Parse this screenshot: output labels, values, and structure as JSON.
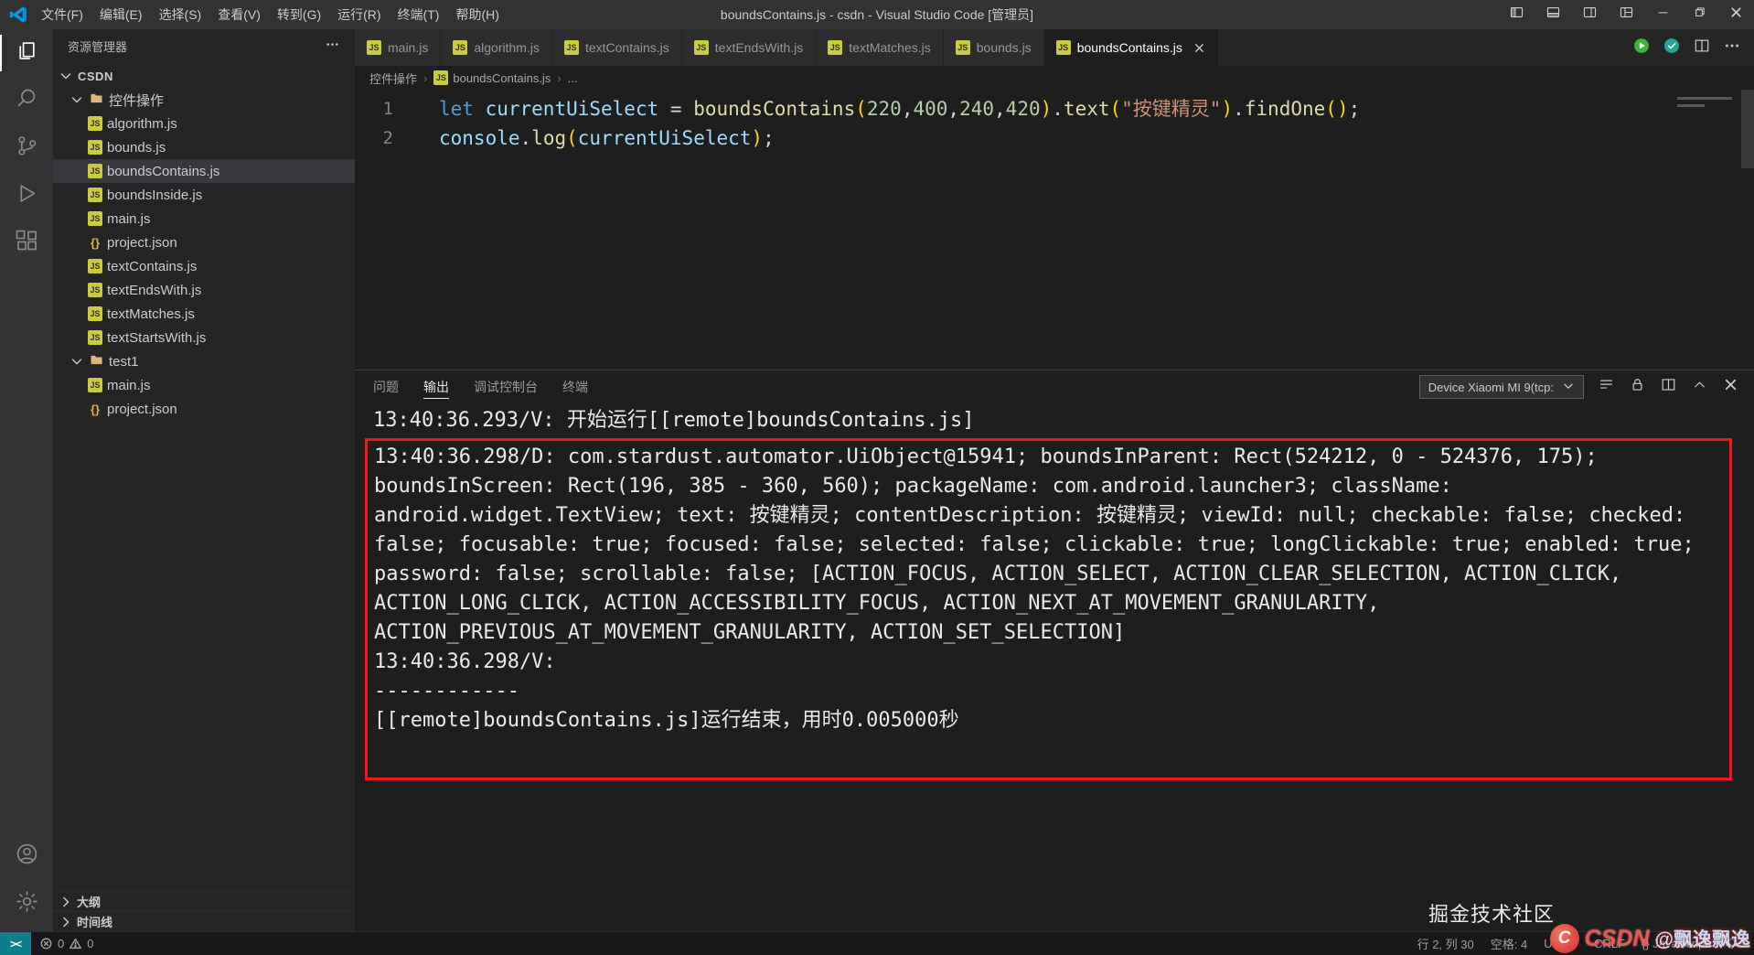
{
  "window": {
    "title": "boundsContains.js - csdn - Visual Studio Code [管理员]"
  },
  "menu_bar": [
    {
      "key": "file",
      "label": "文件(F)"
    },
    {
      "key": "edit",
      "label": "编辑(E)"
    },
    {
      "key": "selection",
      "label": "选择(S)"
    },
    {
      "key": "view",
      "label": "查看(V)"
    },
    {
      "key": "go",
      "label": "转到(G)"
    },
    {
      "key": "run",
      "label": "运行(R)"
    },
    {
      "key": "terminal",
      "label": "终端(T)"
    },
    {
      "key": "help",
      "label": "帮助(H)"
    }
  ],
  "activity_bar": {
    "top": [
      {
        "name": "explorer",
        "icon": "files-icon",
        "active": true
      },
      {
        "name": "search",
        "icon": "search-icon"
      },
      {
        "name": "source-control",
        "icon": "source-control-icon"
      },
      {
        "name": "run-debug",
        "icon": "run-debug-icon"
      },
      {
        "name": "extensions",
        "icon": "extensions-icon"
      }
    ],
    "bottom": [
      {
        "name": "account",
        "icon": "account-icon"
      },
      {
        "name": "settings",
        "icon": "settings-gear-icon"
      }
    ]
  },
  "explorer": {
    "header": "资源管理器",
    "tree": [
      {
        "label": "CSDN",
        "type": "root",
        "indent": 0,
        "expanded": true
      },
      {
        "label": "控件操作",
        "type": "folder",
        "indent": 1,
        "expanded": true
      },
      {
        "label": "algorithm.js",
        "type": "js",
        "indent": 2
      },
      {
        "label": "bounds.js",
        "type": "js",
        "indent": 2
      },
      {
        "label": "boundsContains.js",
        "type": "js",
        "indent": 2,
        "selected": true
      },
      {
        "label": "boundsInside.js",
        "type": "js",
        "indent": 2
      },
      {
        "label": "main.js",
        "type": "js",
        "indent": 2
      },
      {
        "label": "project.json",
        "type": "json",
        "indent": 2
      },
      {
        "label": "textContains.js",
        "type": "js",
        "indent": 2
      },
      {
        "label": "textEndsWith.js",
        "type": "js",
        "indent": 2
      },
      {
        "label": "textMatches.js",
        "type": "js",
        "indent": 2
      },
      {
        "label": "textStartsWith.js",
        "type": "js",
        "indent": 2
      },
      {
        "label": "test1",
        "type": "folder",
        "indent": 1,
        "expanded": true
      },
      {
        "label": "main.js",
        "type": "js",
        "indent": 2
      },
      {
        "label": "project.json",
        "type": "json",
        "indent": 2
      }
    ],
    "bottom_sections": [
      {
        "label": "大纲"
      },
      {
        "label": "时间线"
      }
    ]
  },
  "editor_tabs": [
    {
      "label": "main.js"
    },
    {
      "label": "algorithm.js"
    },
    {
      "label": "textContains.js"
    },
    {
      "label": "textEndsWith.js"
    },
    {
      "label": "textMatches.js"
    },
    {
      "label": "bounds.js"
    },
    {
      "label": "boundsContains.js",
      "active": true
    }
  ],
  "tab_actions": [
    {
      "name": "run",
      "icon": "run-icon"
    },
    {
      "name": "device-connect",
      "icon": "device-connect-icon"
    },
    {
      "name": "split-editor",
      "icon": "split-editor-icon"
    },
    {
      "name": "more-actions",
      "icon": "more-actions-icon"
    }
  ],
  "breadcrumb": [
    {
      "label": "控件操作"
    },
    {
      "label": "boundsContains.js",
      "icon": "js"
    },
    {
      "label": "..."
    }
  ],
  "editor": {
    "lines": [
      {
        "number": "1",
        "tokens": [
          {
            "t": "let",
            "c": "kw"
          },
          {
            "t": " ",
            "c": "pun"
          },
          {
            "t": "currentUiSelect",
            "c": "var"
          },
          {
            "t": " ",
            "c": "pun"
          },
          {
            "t": "=",
            "c": "pun"
          },
          {
            "t": " ",
            "c": "pun"
          },
          {
            "t": "boundsContains",
            "c": "fn"
          },
          {
            "t": "(",
            "c": "br"
          },
          {
            "t": "220",
            "c": "num"
          },
          {
            "t": ",",
            "c": "pun"
          },
          {
            "t": "400",
            "c": "num"
          },
          {
            "t": ",",
            "c": "pun"
          },
          {
            "t": "240",
            "c": "num"
          },
          {
            "t": ",",
            "c": "pun"
          },
          {
            "t": "420",
            "c": "num"
          },
          {
            "t": ")",
            "c": "br"
          },
          {
            "t": ".",
            "c": "pun"
          },
          {
            "t": "text",
            "c": "fn"
          },
          {
            "t": "(",
            "c": "br"
          },
          {
            "t": "\"按键精灵\"",
            "c": "str"
          },
          {
            "t": ")",
            "c": "br"
          },
          {
            "t": ".",
            "c": "pun"
          },
          {
            "t": "findOne",
            "c": "fn"
          },
          {
            "t": "(",
            "c": "br"
          },
          {
            "t": ")",
            "c": "br"
          },
          {
            "t": ";",
            "c": "pun"
          }
        ]
      },
      {
        "number": "2",
        "tokens": [
          {
            "t": "console",
            "c": "var"
          },
          {
            "t": ".",
            "c": "pun"
          },
          {
            "t": "log",
            "c": "fn"
          },
          {
            "t": "(",
            "c": "br"
          },
          {
            "t": "currentUiSelect",
            "c": "var"
          },
          {
            "t": ")",
            "c": "br"
          },
          {
            "t": ";",
            "c": "pun"
          }
        ]
      }
    ]
  },
  "panel": {
    "tabs": [
      {
        "key": "problems",
        "label": "问题"
      },
      {
        "key": "output",
        "label": "输出",
        "active": true
      },
      {
        "key": "debug-console",
        "label": "调试控制台"
      },
      {
        "key": "terminal",
        "label": "终端"
      }
    ],
    "device_selector": "Device Xiaomi MI 9(tcp:",
    "actions": [
      {
        "name": "clear-output",
        "icon": "clear-output-icon"
      },
      {
        "name": "lock-scroll",
        "icon": "lock-icon"
      },
      {
        "name": "open-in-editor",
        "icon": "split-editor-outline-icon"
      },
      {
        "name": "maximize-panel",
        "icon": "chevron-up-icon"
      },
      {
        "name": "close-panel",
        "icon": "close-icon"
      }
    ],
    "output": {
      "lead_line": "13:40:36.293/V: 开始运行[[remote]boundsContains.js]",
      "boxed_lines": [
        "13:40:36.298/D: com.stardust.automator.UiObject@15941; boundsInParent: Rect(524212, 0 - 524376, 175); boundsInScreen: Rect(196, 385 - 360, 560); packageName: com.android.launcher3; className: android.widget.TextView; text: 按键精灵; contentDescription: 按键精灵; viewId: null; checkable: false; checked: false; focusable: true; focused: false; selected: false; clickable: true; longClickable: true; enabled: true; password: false; scrollable: false; [ACTION_FOCUS, ACTION_SELECT, ACTION_CLEAR_SELECTION, ACTION_CLICK, ACTION_LONG_CLICK, ACTION_ACCESSIBILITY_FOCUS, ACTION_NEXT_AT_MOVEMENT_GRANULARITY, ACTION_PREVIOUS_AT_MOVEMENT_GRANULARITY, ACTION_SET_SELECTION]",
        "13:40:36.298/V:",
        "------------",
        "[[remote]boundsContains.js]运行结束，用时0.005000秒"
      ]
    }
  },
  "status_bar": {
    "remote_label": "><",
    "problems": {
      "errors": "0",
      "warnings": "0"
    },
    "right": [
      {
        "name": "cursor-position",
        "label": "行 2, 列 30"
      },
      {
        "name": "indentation",
        "label": "空格: 4"
      },
      {
        "name": "encoding",
        "label": "UTF-8"
      },
      {
        "name": "eol",
        "label": "CRLF"
      },
      {
        "name": "language-mode",
        "label": "{} JavaScript"
      }
    ]
  },
  "watermarks": {
    "juejin": "掘金技术社区",
    "csdn_logo": "C",
    "csdn_text": "CSDN",
    "csdn_handle": "@飘逸飘逸"
  },
  "colors": {
    "accent_blue": "#007acc",
    "annotation_red": "#f01818",
    "run_green": "#3fb33f",
    "device_teal": "#26a69a",
    "remote_teal": "#0e7f8a",
    "folder_tan": "#dcb67a",
    "js_yellow": "#cbcb41",
    "json_orange": "#e8b04e",
    "selection_row": "#37373d",
    "syntax_keyword": "#569cd6",
    "syntax_variable": "#9cdcfe",
    "syntax_function": "#dcdcaa",
    "syntax_number": "#b5cea8",
    "syntax_string": "#ce9178",
    "syntax_punctuation": "#d4d4d4",
    "syntax_bracket": "#ffd700"
  }
}
